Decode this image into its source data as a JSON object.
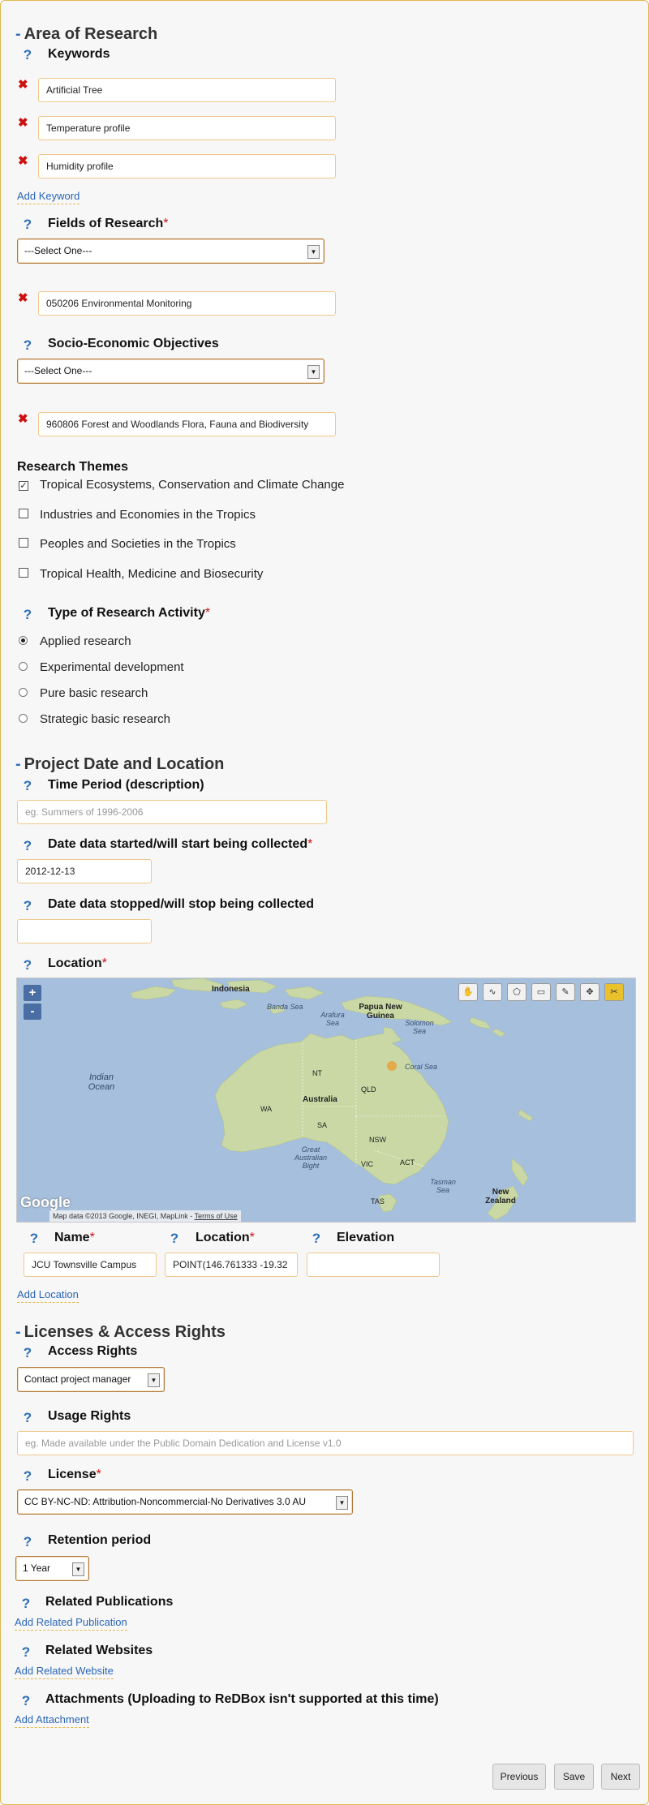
{
  "sections": {
    "area": "Area of Research",
    "project": "Project Date and Location",
    "licenses": "Licenses & Access Rights"
  },
  "labels": {
    "keywords": "Keywords",
    "fields_of_research": "Fields of Research",
    "seo": "Socio-Economic Objectives",
    "research_themes": "Research Themes",
    "type_of_activity": "Type of Research Activity",
    "time_period": "Time Period (description)",
    "date_started": "Date data started/will start being collected",
    "date_stopped": "Date data stopped/will stop being collected",
    "location": "Location",
    "name": "Name",
    "location_col": "Location",
    "elevation": "Elevation",
    "access_rights": "Access Rights",
    "usage_rights": "Usage Rights",
    "license": "License",
    "retention": "Retention period",
    "related_publications": "Related Publications",
    "related_websites": "Related Websites",
    "attachments": "Attachments (Uploading to ReDBox isn't supported at this time)"
  },
  "required_mark": "*",
  "help_icon": "?",
  "remove_icon": "✖",
  "keywords": [
    "Artificial Tree",
    "Temperature profile",
    "Humidity profile"
  ],
  "for_select": "---Select One---",
  "for_value": "050206 Environmental Monitoring",
  "seo_select": "---Select One---",
  "seo_value": "960806 Forest and Woodlands Flora, Fauna and Biodiversity",
  "themes": [
    {
      "label": "Tropical Ecosystems, Conservation and Climate Change",
      "checked": true
    },
    {
      "label": "Industries and Economies in the Tropics",
      "checked": false
    },
    {
      "label": "Peoples and Societies in the Tropics",
      "checked": false
    },
    {
      "label": "Tropical Health, Medicine and Biosecurity",
      "checked": false
    }
  ],
  "activity_types": [
    {
      "label": "Applied research",
      "selected": true
    },
    {
      "label": "Experimental development",
      "selected": false
    },
    {
      "label": "Pure basic research",
      "selected": false
    },
    {
      "label": "Strategic basic research",
      "selected": false
    }
  ],
  "time_period_placeholder": "eg. Summers of 1996-2006",
  "date_started": "2012-12-13",
  "date_stopped": "",
  "map": {
    "zoom_in": "+",
    "zoom_out": "-",
    "tools": [
      "hand-icon",
      "draw-path-icon",
      "draw-polygon-icon",
      "draw-box-icon",
      "edit-icon",
      "move-icon",
      "delete-icon"
    ],
    "places": {
      "indonesia": "Indonesia",
      "banda_sea": "Banda Sea",
      "arafura_sea": "Arafura Sea",
      "papua": "Papua New Guinea",
      "solomon_sea": "Solomon Sea",
      "coral_sea": "Coral Sea",
      "indian_ocean": "Indian Ocean",
      "nt": "NT",
      "qld": "QLD",
      "wa": "WA",
      "australia": "Australia",
      "sa": "SA",
      "nsw": "NSW",
      "act": "ACT",
      "vic": "VIC",
      "tas": "TAS",
      "gab": "Great Australian Bight",
      "tasman_sea": "Tasman Sea",
      "new_zealand": "New Zealand"
    },
    "logo": "Google",
    "attribution": "Map data ©2013 Google, INEGI, MapLink -",
    "terms": "Terms of Use"
  },
  "location_row": {
    "name": "JCU Townsville Campus",
    "location": "POINT(146.761333 -19.32",
    "elevation": ""
  },
  "links": {
    "add_keyword": "Add Keyword",
    "add_location": "Add Location",
    "add_publication": "Add Related Publication",
    "add_website": "Add Related Website",
    "add_attachment": "Add Attachment"
  },
  "access_rights": "Contact project manager",
  "usage_rights_placeholder": "eg. Made available under the Public Domain Dedication and License v1.0",
  "license_value": "CC BY-NC-ND: Attribution-Noncommercial-No Derivatives 3.0 AU",
  "retention_value": "1 Year",
  "buttons": {
    "previous": "Previous",
    "save": "Save",
    "next": "Next"
  },
  "colors": {
    "accent_blue": "#2d6fb8",
    "required_red": "#cc1111",
    "border_gold": "#e2b94c",
    "active_tool": "#e9c12c"
  }
}
